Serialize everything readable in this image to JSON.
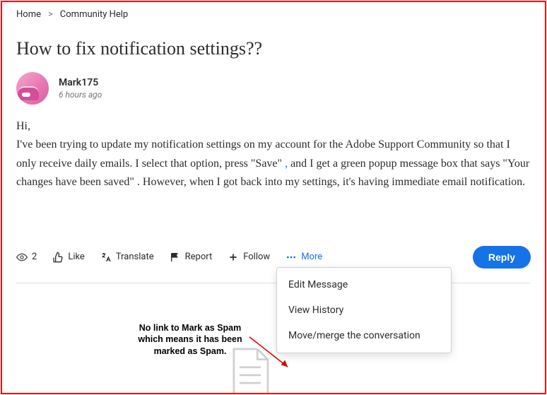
{
  "breadcrumb": {
    "home": "Home",
    "section": "Community Help"
  },
  "post": {
    "title": "How to fix notification settings??",
    "author": "Mark175",
    "timestamp": "6 hours ago",
    "greeting": "Hi,",
    "para": "I've been trying to update my notification settings on my account for the Adobe Support Community so that I only receive daily emails. I select that option, press \"Save\" ",
    "link_comma": ",",
    "para2": " and I get a green popup message box that says \"Your changes have been saved\" . However, when I got back into my settings, it's having immediate email notification."
  },
  "actions": {
    "views_count": "2",
    "like": "Like",
    "translate": "Translate",
    "report": "Report",
    "follow": "Follow",
    "more": "More",
    "reply": "Reply"
  },
  "more_menu": {
    "edit": "Edit Message",
    "history": "View History",
    "movemerge": "Move/merge the conversation"
  },
  "annotation": "No link to Mark as Spam which means it has been marked as Spam."
}
